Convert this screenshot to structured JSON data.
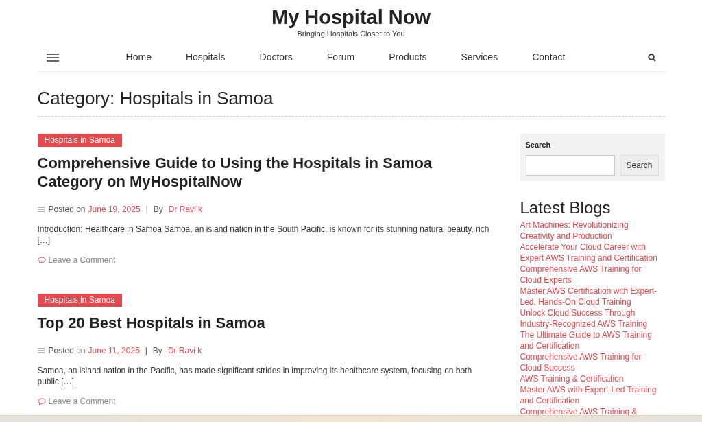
{
  "site": {
    "title": "My Hospital Now",
    "tagline": "Bringing Hospitals Closer to You"
  },
  "nav": [
    {
      "label": "Home"
    },
    {
      "label": "Hospitals"
    },
    {
      "label": "Doctors"
    },
    {
      "label": "Forum"
    },
    {
      "label": "Products"
    },
    {
      "label": "Services"
    },
    {
      "label": "Contact"
    }
  ],
  "page_title": "Category: Hospitals in Samoa",
  "posts": [
    {
      "category": "Hospitals in Samoa",
      "title": "Comprehensive Guide to Using the Hospitals in Samoa Category on MyHospitalNow",
      "posted_label": "Posted on",
      "date": "June 19, 2025",
      "separator": "|",
      "by_label": "By",
      "author": "Dr Ravi k",
      "excerpt": "Introduction: Healthcare in Samoa Samoa, an island nation in the South Pacific, is known for its stunning natural beauty, rich […]",
      "comment": "Leave a Comment"
    },
    {
      "category": "Hospitals in Samoa",
      "title": "Top 20 Best Hospitals in Samoa",
      "posted_label": "Posted on",
      "date": "June 11, 2025",
      "separator": "|",
      "by_label": "By",
      "author": "Dr Ravi k",
      "excerpt": "Samoa, an island nation in the Pacific, has made significant strides in improving its healthcare system, focusing on both public […]",
      "comment": "Leave a Comment"
    }
  ],
  "sidebar": {
    "search": {
      "label": "Search",
      "button": "Search"
    },
    "latest_title": "Latest Blogs",
    "latest": [
      "Art Machines: Revolutionizing Creativity and Production",
      "Accelerate Your Cloud Career with Expert AWS Training and Certification",
      "Comprehensive AWS Training for Cloud Experts",
      "Master AWS Certification with Expert-Led, Hands-On Cloud Training",
      "Unlock Cloud Success Through Industry-Recognized AWS Training",
      "The Ultimate Guide to AWS Training and Certification",
      "Comprehensive AWS Training for Cloud Success",
      "AWS Training & Certification",
      "Master AWS with Expert-Led Training and Certification",
      "Comprehensive AWS Training &"
    ]
  }
}
